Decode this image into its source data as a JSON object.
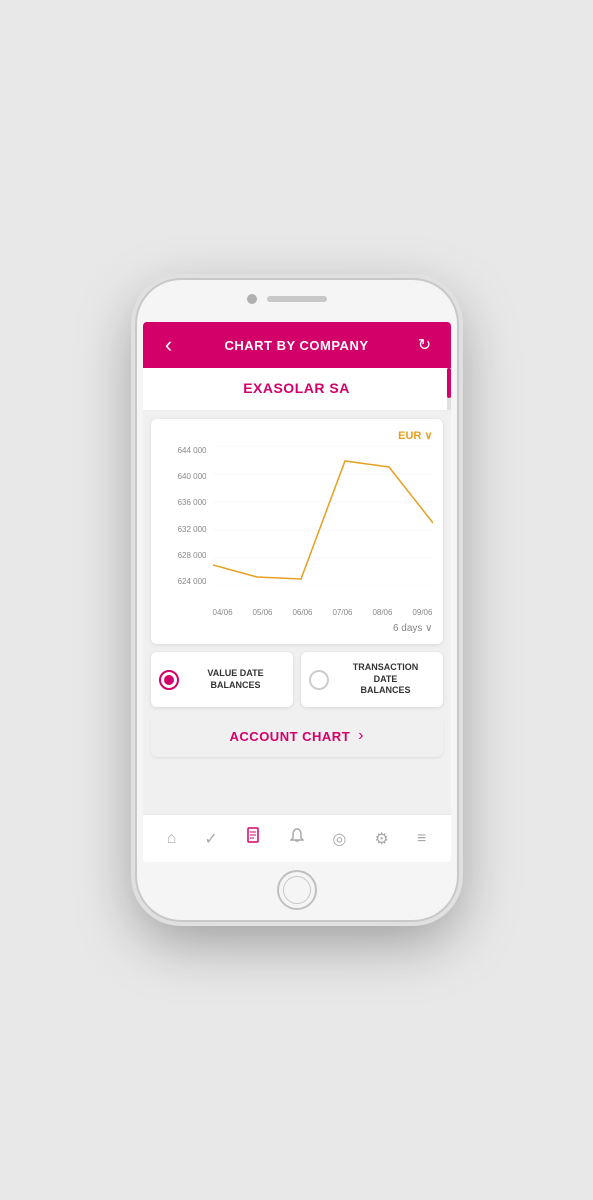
{
  "phone": {
    "header": {
      "back_label": "‹",
      "title": "CHART BY COMPANY",
      "refresh_label": "↻"
    },
    "company": {
      "name": "EXASOLAR SA"
    },
    "chart": {
      "currency": "EUR",
      "currency_chevron": "∨",
      "y_labels": [
        "644 000",
        "640 000",
        "636 000",
        "632 000",
        "628 000",
        "624 000"
      ],
      "x_labels": [
        "04/06",
        "05/06",
        "06/06",
        "07/06",
        "08/06",
        "09/06"
      ],
      "days_selector": "6 days ∨"
    },
    "balance_options": [
      {
        "label": "VALUE DATE\nBALANCES",
        "selected": true
      },
      {
        "label": "TRANSACTION\nDATE\nBALANCES",
        "selected": false
      }
    ],
    "account_chart": {
      "label": "ACCOUNT CHART",
      "arrow": "›"
    },
    "bottom_nav": [
      {
        "icon": "⌂",
        "name": "home",
        "active": false
      },
      {
        "icon": "✓",
        "name": "check",
        "active": false
      },
      {
        "icon": "📄",
        "name": "document",
        "active": true
      },
      {
        "icon": "🔔",
        "name": "bell",
        "active": false
      },
      {
        "icon": "◎",
        "name": "eye",
        "active": false
      },
      {
        "icon": "⚙",
        "name": "settings",
        "active": false
      },
      {
        "icon": "≡",
        "name": "menu",
        "active": false
      }
    ],
    "colors": {
      "primary": "#d4006a",
      "accent": "#e6a020",
      "text_dark": "#333333",
      "text_gray": "#888888",
      "background": "#f0f0f0",
      "white": "#ffffff"
    }
  }
}
